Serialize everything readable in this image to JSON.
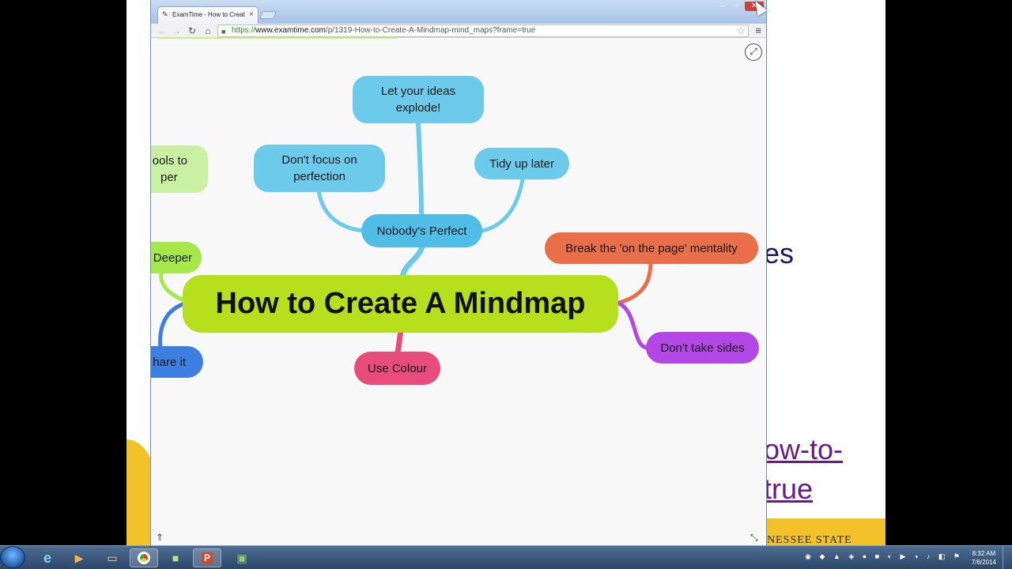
{
  "browser": {
    "tab_title": "ExamTime - How to Creat",
    "tab_close": "×",
    "url_scheme": "https://",
    "url_host": "www.examtime.com",
    "url_path": "/p/1319-How-to-Create-A-Mindmap-mind_maps?frame=true",
    "window_controls": {
      "minimize": "–",
      "maximize": "▫",
      "close": "✕"
    }
  },
  "mindmap": {
    "central": "How to Create A Mindmap",
    "nodes": {
      "nobody_perfect": "Nobody's Perfect",
      "let_ideas_line1": "Let your ideas",
      "let_ideas_line2": "explode!",
      "dont_focus_line1": "Don't focus on",
      "dont_focus_line2": "perfection",
      "tidy_up": "Tidy up later",
      "break_page": "Break the 'on the page' mentality",
      "dont_take_sides": "Don't take sides",
      "use_colour": "Use Colour",
      "tools_line1": "ools to",
      "tools_line2": "per",
      "deeper": "Deeper",
      "share": "hare it"
    },
    "colors": {
      "central": "#b6df1e",
      "blue": "#6ccaea",
      "orange": "#e86f4a",
      "purple": "#b347e6",
      "pink": "#e84c7c",
      "green": "#a6e84a",
      "light_green": "#c9f0a3",
      "dark_blue": "#3d7fe0"
    }
  },
  "background_slide": {
    "frag_es": "es",
    "frag_link1": "ow-to-",
    "frag_link2": "true",
    "footer": "NESSEE STATE"
  },
  "taskbar": {
    "clock_time": "8:32 AM",
    "clock_date": "7/8/2014"
  }
}
